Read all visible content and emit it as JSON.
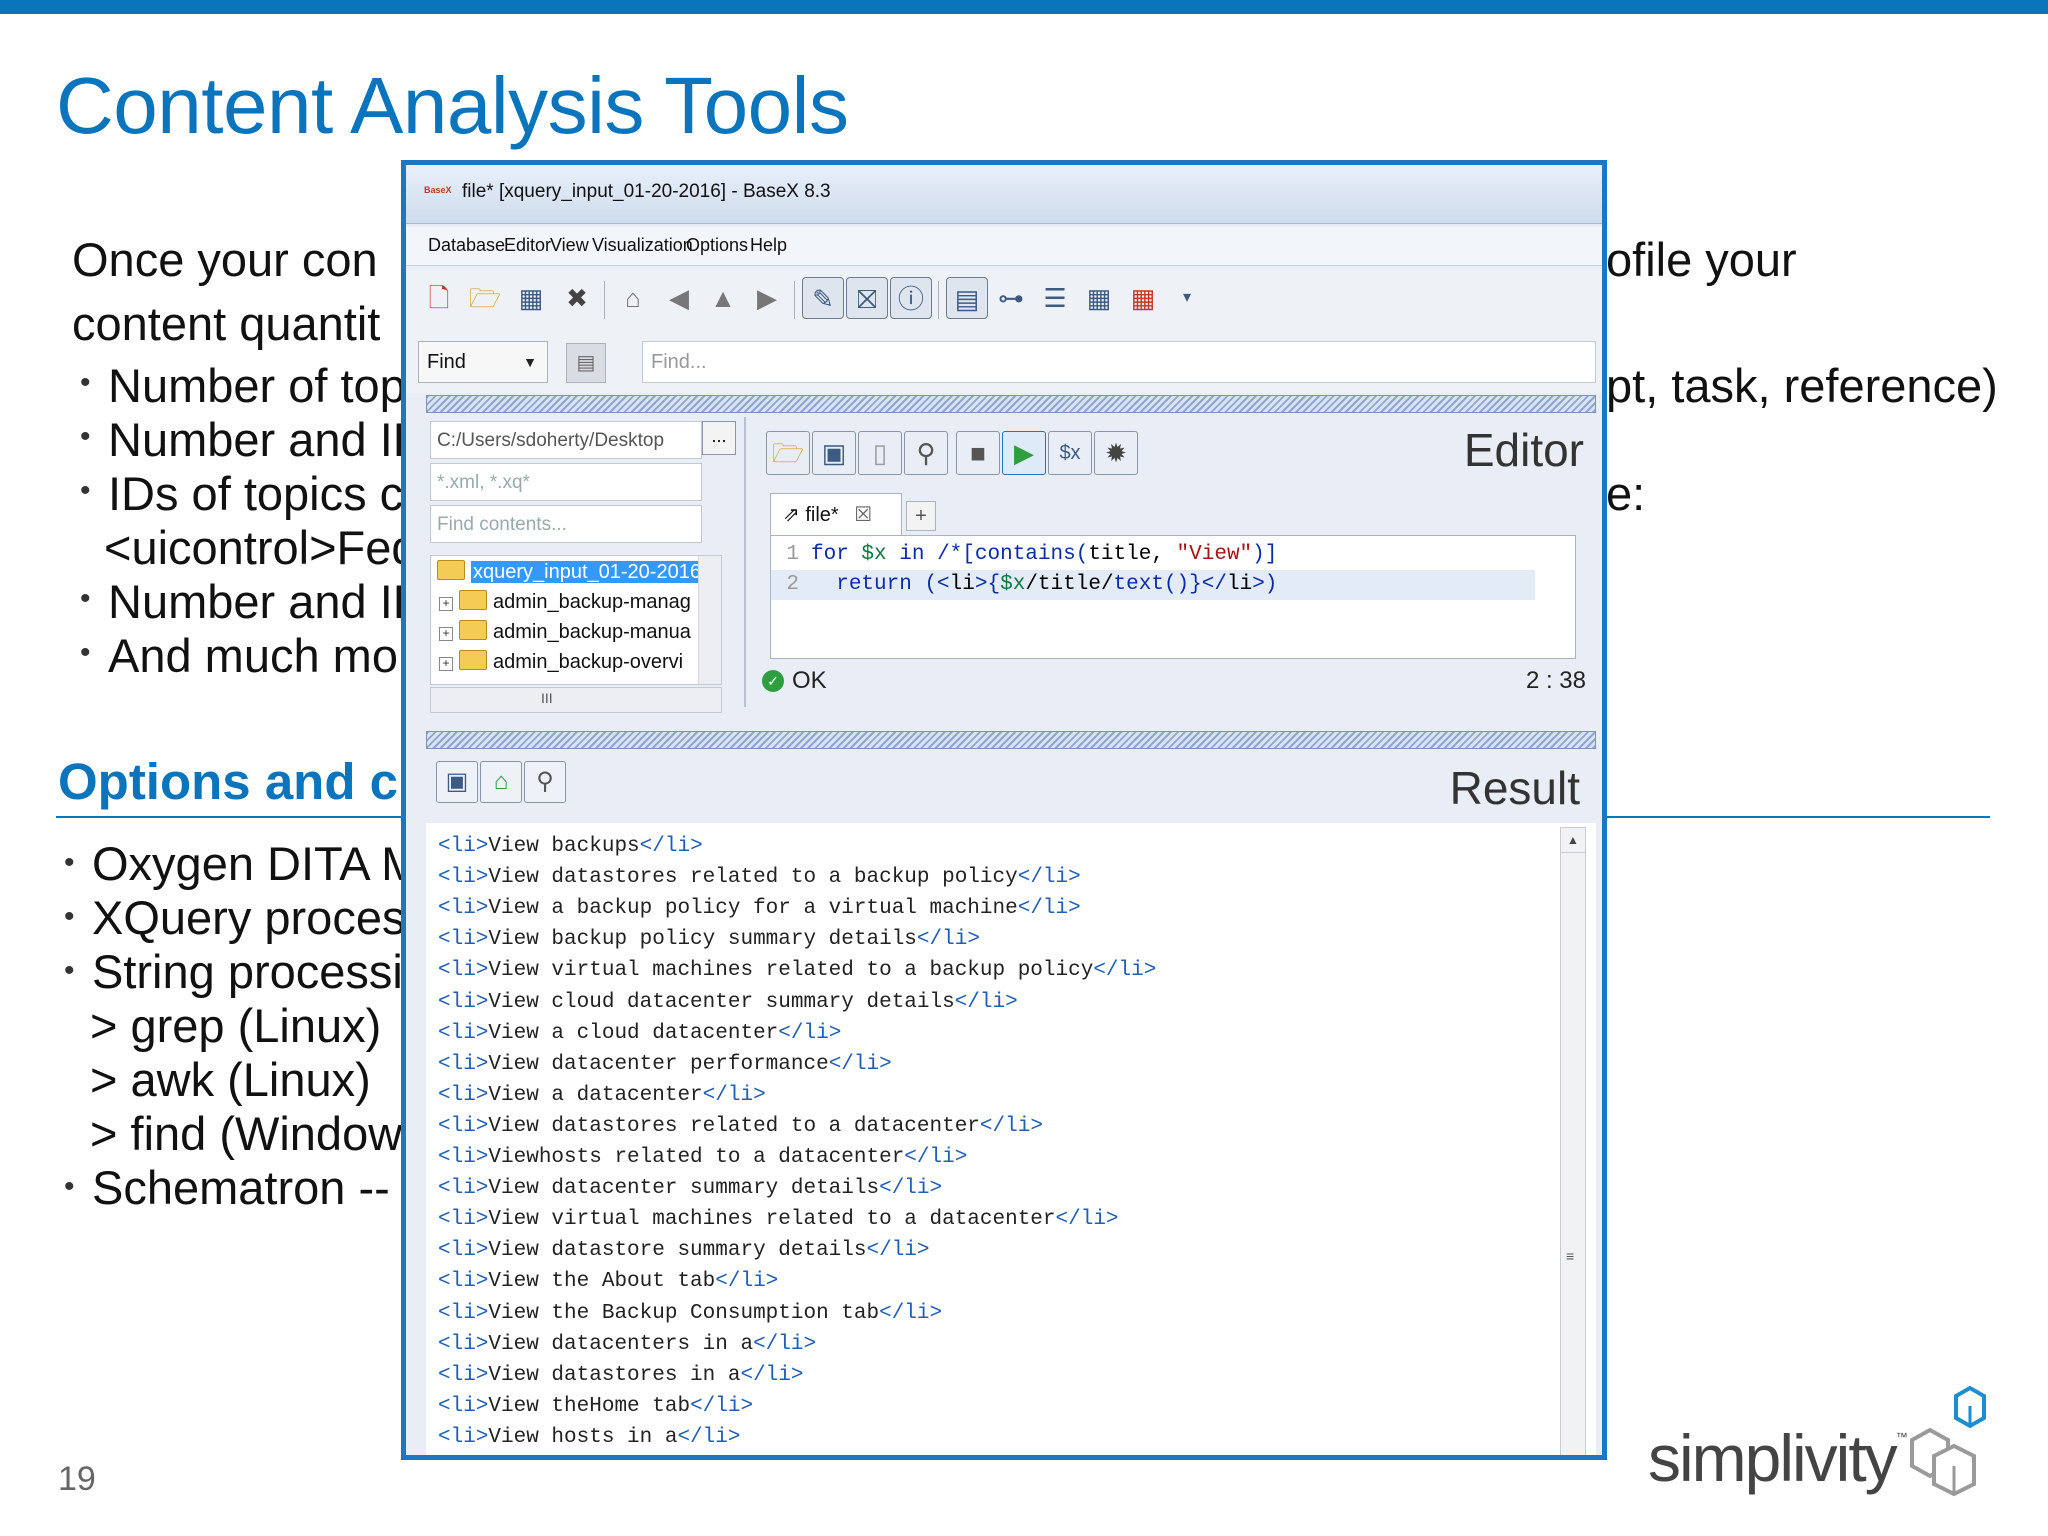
{
  "slide": {
    "title": "Content Analysis Tools",
    "intro_line1": "Once your con",
    "intro_line1_right": "ofile your",
    "intro_line2": "content quantit",
    "bullets": [
      {
        "left": "Number of topi",
        "right": "pt, task, reference)"
      },
      {
        "left": "Number and ID",
        "right": ""
      },
      {
        "left": "IDs of topics c",
        "right": "e:"
      },
      {
        "left": "<uicontrol>Fed",
        "right": ""
      },
      {
        "left": "Number and ID",
        "right": ""
      },
      {
        "left": "And much mor",
        "right": ""
      }
    ],
    "section_heading": "Options and c",
    "tools": [
      "Oxygen DITA M",
      "XQuery process",
      "String processi",
      "> grep (Linux)",
      "> awk (Linux)",
      "> find (Windows",
      "Schematron -- f"
    ],
    "page_number": "19",
    "logo_text": "simplivity",
    "logo_tm": "™"
  },
  "window": {
    "app_icon": "BaseX",
    "title": "file* [xquery_input_01-20-2016] - BaseX 8.3",
    "menu": [
      "Database",
      "Editor",
      "View",
      "Visualization",
      "Options",
      "Help"
    ],
    "toolbar_icons": [
      "new-file-icon",
      "open-folder-icon",
      "database-icon",
      "close-icon",
      "home-icon",
      "back-arrow-icon",
      "up-arrow-icon",
      "forward-arrow-icon",
      "edit-icon",
      "stop-icon",
      "info-icon",
      "table-view-icon",
      "tree-view-icon",
      "outline-icon",
      "grid-icon",
      "table-icon",
      "dropdown-icon"
    ],
    "find_mode": "Find",
    "find_placeholder": "Find...",
    "explorer": {
      "path": "C:/Users/sdoherty/Desktop",
      "browse_label": "...",
      "filter": "*.xml, *.xq*",
      "find_contents_placeholder": "Find contents...",
      "tree": [
        {
          "label": "xquery_input_01-20-2016",
          "selected": true,
          "expandable": false
        },
        {
          "label": "admin_backup-manag",
          "selected": false,
          "expandable": true
        },
        {
          "label": "admin_backup-manua",
          "selected": false,
          "expandable": true
        },
        {
          "label": "admin_backup-overvi",
          "selected": false,
          "expandable": true
        }
      ],
      "hscroll_grip": "III"
    },
    "editor": {
      "title": "Editor",
      "tab_label": "file*",
      "tab_close": "☒",
      "tab_add": "+",
      "line1_no": "1",
      "line2_no": "2",
      "status": "OK",
      "cursor_pos": "2 : 38"
    },
    "result": {
      "title": "Result",
      "lines": [
        "View backups",
        "View datastores related to a backup policy",
        "View a backup policy for a virtual machine",
        "View backup policy summary details",
        "View virtual machines related to a backup policy",
        "View cloud datacenter summary details",
        "View a cloud datacenter",
        "View datacenter performance",
        "View a datacenter",
        "View datastores related to a datacenter",
        "Viewhosts related to a datacenter",
        "View datacenter summary details",
        "View virtual machines related to a datacenter",
        "View datastore summary details",
        "View the About tab",
        "View the Backup Consumption tab",
        "View datacenters in a",
        "View datastores in a",
        "View theHome tab",
        "View hosts in a"
      ]
    }
  },
  "colors": {
    "accent": "#0a74bd",
    "window_border": "#1c77c3",
    "tag": "#1f5fb5"
  }
}
